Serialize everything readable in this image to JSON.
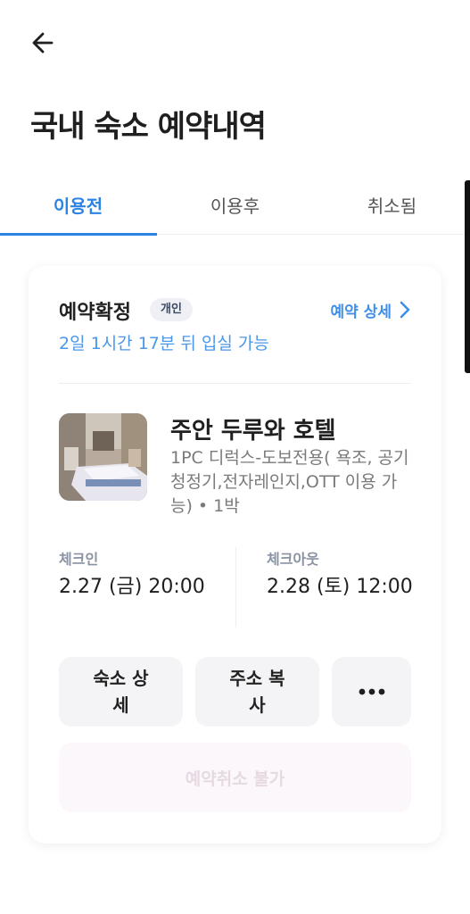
{
  "header": {
    "back_icon": "arrow-left-icon",
    "title": "국내 숙소 예약내역"
  },
  "tabs": [
    {
      "label": "이용전",
      "active": true
    },
    {
      "label": "이용후",
      "active": false
    },
    {
      "label": "취소됨",
      "active": false
    }
  ],
  "colors": {
    "accent": "#2b84e3",
    "link": "#3f8ee8"
  },
  "reservation": {
    "status": "예약확정",
    "badge": "개인",
    "detail_link": "예약 상세",
    "remaining": "2일 1시간 17분 뒤 입실 가능",
    "hotel_name": "주안 두루와 호텔",
    "room_description": "1PC 디럭스-도보전용( 욕조, 공기청정기,전자레인지,OTT 이용 가능) • 1박",
    "checkin": {
      "label": "체크인",
      "value": "2.27 (금) 20:00"
    },
    "checkout": {
      "label": "체크아웃",
      "value": "2.28 (토) 12:00"
    },
    "actions": {
      "hotel_detail": "숙소 상세",
      "copy_address": "주소 복사",
      "more_icon": "more-dots-icon"
    },
    "cancel_label": "예약취소 불가"
  }
}
